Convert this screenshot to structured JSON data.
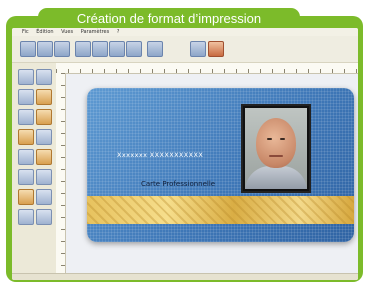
{
  "header": {
    "title": "Création de format d’impression"
  },
  "app": {
    "menu": [
      "Fic",
      "Édition",
      "Vues",
      "Paramètres",
      "?"
    ],
    "status": {
      "left": "",
      "center": "",
      "right": ""
    }
  },
  "card": {
    "name_text": "Xxxxxxx XXXXXXXXXXX",
    "role_text": "Carte Professionnelle"
  },
  "colors": {
    "frame_green": "#7cbb2a",
    "card_blue": "#3f78b8",
    "band_gold": "#e7c25e"
  }
}
